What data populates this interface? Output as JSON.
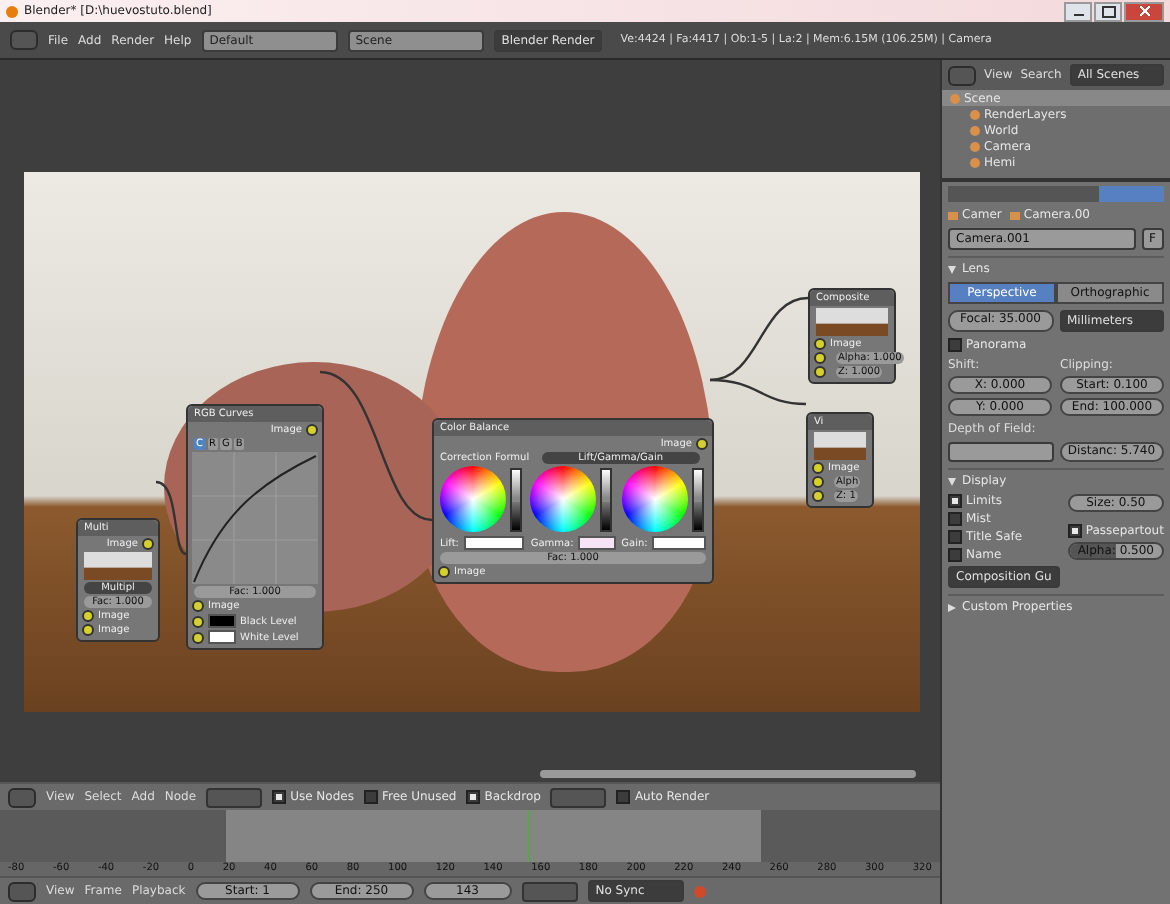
{
  "window": {
    "title": "Blender* [D:\\huevostuto.blend]"
  },
  "top_bar": {
    "menus": [
      "File",
      "Add",
      "Render",
      "Help"
    ],
    "layout": "Default",
    "scene": "Scene",
    "engine": "Blender Render",
    "stats": "Ve:4424 | Fa:4417 | Ob:1-5 | La:2 | Mem:6.15M (106.25M) | Camera"
  },
  "nodes": [
    {
      "kind": "mix",
      "title": "Multi",
      "outputs": [
        "Image"
      ],
      "mode": "Multipl",
      "fac": "Fac: 1.000",
      "inputs": [
        {
          "label": "Image"
        },
        {
          "label": "Image"
        }
      ]
    },
    {
      "kind": "curves",
      "title": "RGB Curves",
      "outputs": [
        "Image"
      ],
      "channels": [
        {
          "label": "C",
          "selected": true
        },
        {
          "label": "R",
          "selected": false
        },
        {
          "label": "G",
          "selected": false
        },
        {
          "label": "B",
          "selected": false
        }
      ],
      "fac": "Fac: 1.000",
      "inputs": [
        {
          "label": "Image"
        },
        {
          "label": "Black Level",
          "color": "#000000"
        },
        {
          "label": "White Level",
          "color": "#ffffff"
        }
      ]
    },
    {
      "kind": "color_balance",
      "title": "Color Balance",
      "outputs": [
        "Image"
      ],
      "formula_label": "Correction Formul",
      "formula": "Lift/Gamma/Gain",
      "wheels": [
        {
          "label": "Lift:",
          "color": "#ffffff",
          "level": 0.5
        },
        {
          "label": "Gamma:",
          "color": "#f6e4f6",
          "level": 0.5
        },
        {
          "label": "Gain:",
          "color": "#ffffff",
          "level": 0.5
        }
      ],
      "fac": "Fac: 1.000",
      "inputs": [
        {
          "label": "Image"
        }
      ]
    },
    {
      "kind": "composite",
      "title": "Composite",
      "inputs": [
        {
          "label": "Image"
        },
        {
          "label": "Alpha: 1.000"
        },
        {
          "label": "Z: 1.000"
        }
      ]
    },
    {
      "kind": "viewer",
      "title": "Vi",
      "inputs": [
        {
          "label": "Image"
        },
        {
          "label": "Alph"
        },
        {
          "label": "Z: 1"
        }
      ]
    }
  ],
  "node_header": {
    "menus": [
      "View",
      "Select",
      "Add",
      "Node"
    ],
    "options": [
      {
        "label": "Use Nodes",
        "checked": true
      },
      {
        "label": "Free Unused",
        "checked": false
      },
      {
        "label": "Backdrop",
        "checked": true
      }
    ],
    "auto_render": {
      "label": "Auto Render",
      "checked": false
    }
  },
  "timeline": {
    "ticks": [
      "-80",
      "-60",
      "-40",
      "-20",
      "0",
      "20",
      "40",
      "60",
      "80",
      "100",
      "120",
      "140",
      "160",
      "180",
      "200",
      "220",
      "240",
      "260",
      "280",
      "300",
      "320"
    ],
    "current": {
      "level": 0.561
    }
  },
  "timeline_header": {
    "menus": [
      "View",
      "Frame",
      "Playback"
    ],
    "start": "Start: 1",
    "end": "End: 250",
    "frame": "143",
    "sync": "No Sync"
  },
  "outliner": {
    "menus": [
      "View",
      "Search"
    ],
    "filter": "All Scenes",
    "tree": [
      {
        "label": "Scene",
        "children": [
          {
            "label": "RenderLayers"
          },
          {
            "label": "World"
          },
          {
            "label": "Camera"
          },
          {
            "label": "Hemi"
          }
        ]
      }
    ]
  },
  "properties": {
    "breadcrumb": [
      "Camer",
      "Camera.00"
    ],
    "datablock": "Camera.001",
    "fake_user": "F",
    "lens": {
      "title": "Lens",
      "expanded": true,
      "projection": [
        {
          "label": "Perspective",
          "selected": true
        },
        {
          "label": "Orthographic",
          "selected": false
        }
      ],
      "focal": "Focal: 35.000",
      "unit": "Millimeters",
      "panorama": {
        "label": "Panorama",
        "checked": false
      },
      "shift_label": "Shift:",
      "shift": [
        "X: 0.000",
        "Y: 0.000"
      ],
      "clipping_label": "Clipping:",
      "clipping": [
        "Start: 0.100",
        "End: 100.000"
      ],
      "dof_label": "Depth of Field:",
      "distance": "Distanc: 5.740"
    },
    "display": {
      "title": "Display",
      "expanded": true,
      "checks": [
        {
          "label": "Limits",
          "checked": true
        },
        {
          "label": "Mist",
          "checked": false
        },
        {
          "label": "Title Safe",
          "checked": false
        },
        {
          "label": "Name",
          "checked": false
        }
      ],
      "size": "Size: 0.50",
      "passepartout": {
        "label": "Passepartout",
        "checked": true
      },
      "alpha": {
        "label": "Alpha: 0.500",
        "level": 0.5
      },
      "guides": "Composition Gu"
    },
    "custom": {
      "title": "Custom Properties",
      "expanded": false
    }
  }
}
